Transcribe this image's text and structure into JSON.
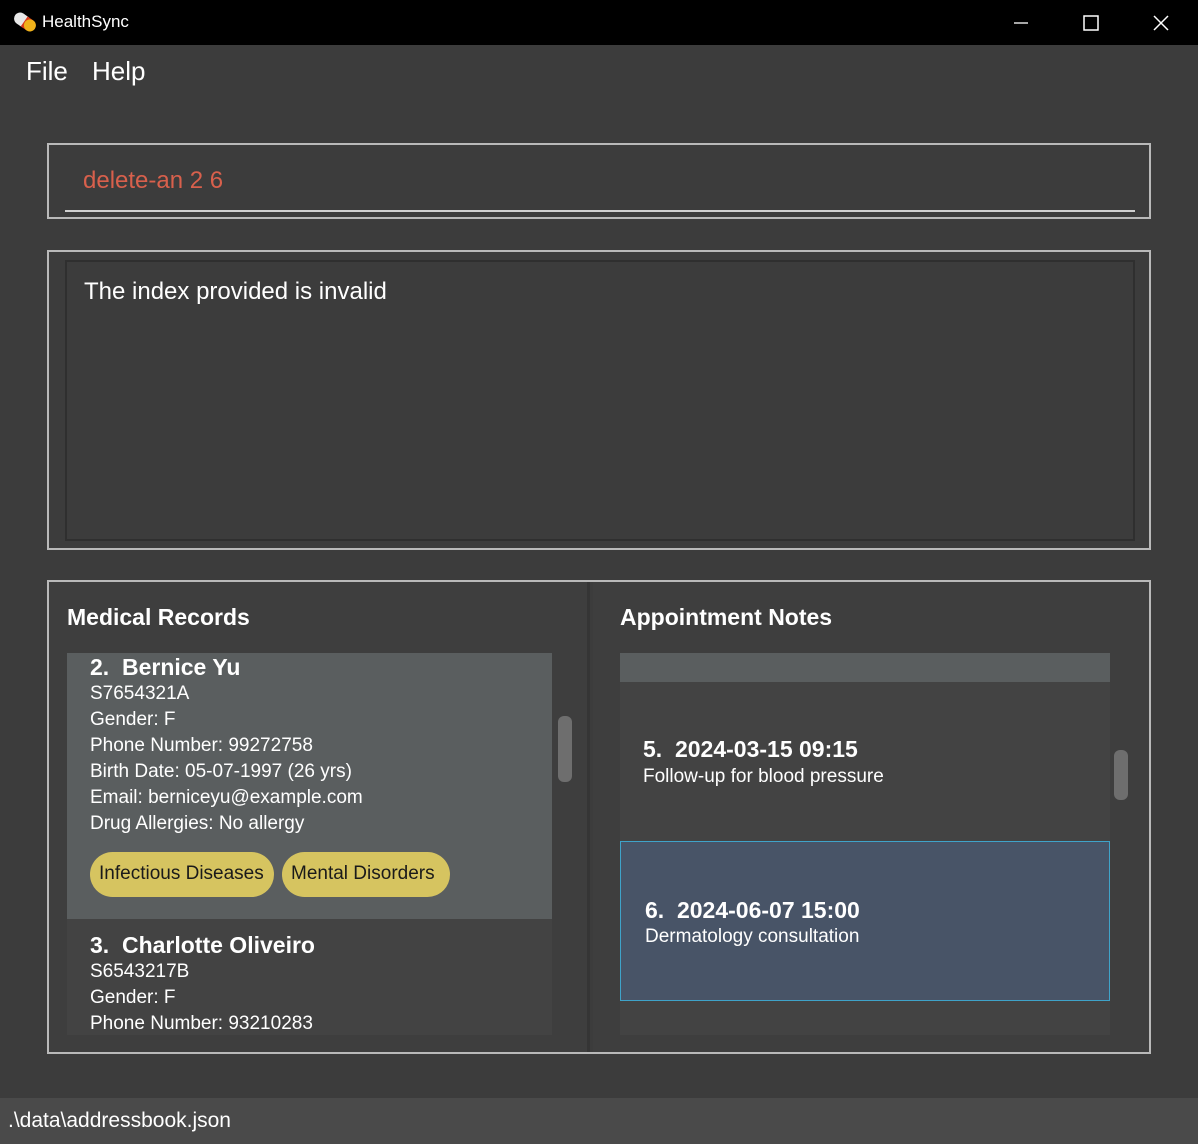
{
  "window": {
    "title": "HealthSync",
    "app_icon": "pill-icon"
  },
  "menu": {
    "items": [
      "File",
      "Help"
    ]
  },
  "command": {
    "value": "delete-an 2 6",
    "text_color": "#d8604c"
  },
  "result": {
    "message": "The index provided is invalid"
  },
  "medical_records": {
    "title": "Medical Records",
    "patients": [
      {
        "index": "2.",
        "name": "Bernice Yu",
        "nric": "S7654321A",
        "gender": "Gender: F",
        "phone": "Phone Number: 99272758",
        "birth": "Birth Date: 05-07-1997 (26 yrs)",
        "email": "Email: berniceyu@example.com",
        "allergies": "Drug Allergies: No allergy",
        "tags": [
          "Infectious Diseases",
          "Mental Disorders"
        ]
      },
      {
        "index": "3.",
        "name": "Charlotte Oliveiro",
        "nric": "S6543217B",
        "gender": "Gender: F",
        "phone": "Phone Number: 93210283"
      }
    ]
  },
  "appointment_notes": {
    "title": "Appointment Notes",
    "notes": [
      {
        "index": "5.",
        "datetime": "2024-03-15 09:15",
        "description": "Follow-up for blood pressure"
      },
      {
        "index": "6.",
        "datetime": "2024-06-07 15:00",
        "description": "Dermatology consultation",
        "selected": true
      }
    ]
  },
  "status": {
    "path": ".\\data\\addressbook.json"
  },
  "colors": {
    "tag": "#d6c460",
    "selected_card": "#485467",
    "selected_border": "#3fa3c9"
  }
}
